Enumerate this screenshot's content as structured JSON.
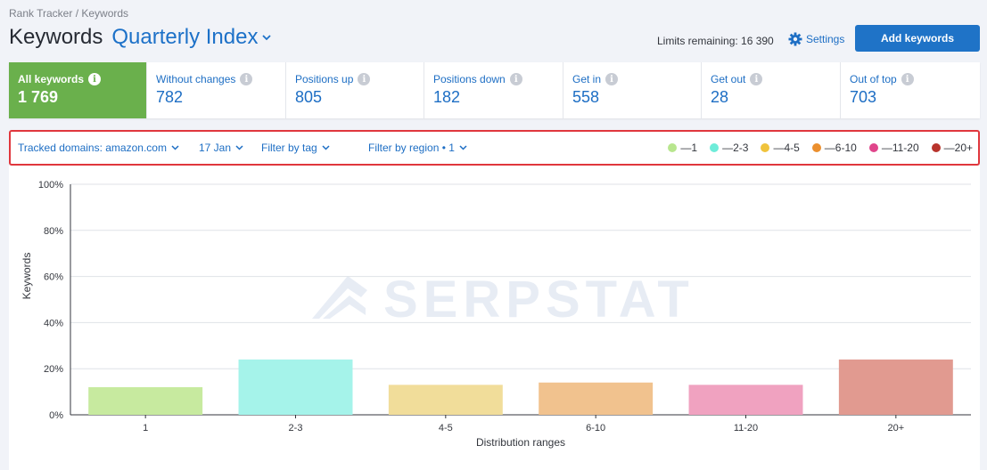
{
  "breadcrumb": "Rank Tracker / Keywords",
  "title": "Keywords",
  "project": "Quarterly Index",
  "limits": "Limits remaining: 16 390",
  "settings": "Settings",
  "add_keywords": "Add keywords",
  "tabs": [
    {
      "label": "All keywords",
      "value": "1 769",
      "active": true
    },
    {
      "label": "Without changes",
      "value": "782"
    },
    {
      "label": "Positions up",
      "value": "805"
    },
    {
      "label": "Positions down",
      "value": "182"
    },
    {
      "label": "Get in",
      "value": "558"
    },
    {
      "label": "Get out",
      "value": "28"
    },
    {
      "label": "Out of top",
      "value": "703"
    }
  ],
  "filters": {
    "domains": "Tracked domains: amazon.com",
    "date": "17 Jan",
    "tag": "Filter by tag",
    "region": "Filter by region • 1"
  },
  "legend": [
    {
      "label": "—1",
      "color": "#b8e68e"
    },
    {
      "label": "—2-3",
      "color": "#6eecd9"
    },
    {
      "label": "—4-5",
      "color": "#f0c33c"
    },
    {
      "label": "—6-10",
      "color": "#eb8f2e"
    },
    {
      "label": "—11-20",
      "color": "#e0458b"
    },
    {
      "label": "—20+",
      "color": "#b8342c"
    }
  ],
  "watermark": "SERPSTAT",
  "chart_data": {
    "type": "bar",
    "categories": [
      "1",
      "2-3",
      "4-5",
      "6-10",
      "11-20",
      "20+"
    ],
    "values": [
      12,
      24,
      13,
      14,
      13,
      24
    ],
    "colors": [
      "#c7ea9f",
      "#a5f3ea",
      "#f1dd9a",
      "#f1c28e",
      "#f0a2c0",
      "#e19a90"
    ],
    "xlabel": "Distribution ranges",
    "ylabel": "Keywords",
    "ylim": [
      0,
      100
    ],
    "yticks": [
      "0%",
      "20%",
      "40%",
      "60%",
      "80%",
      "100%"
    ],
    "grid": true
  }
}
